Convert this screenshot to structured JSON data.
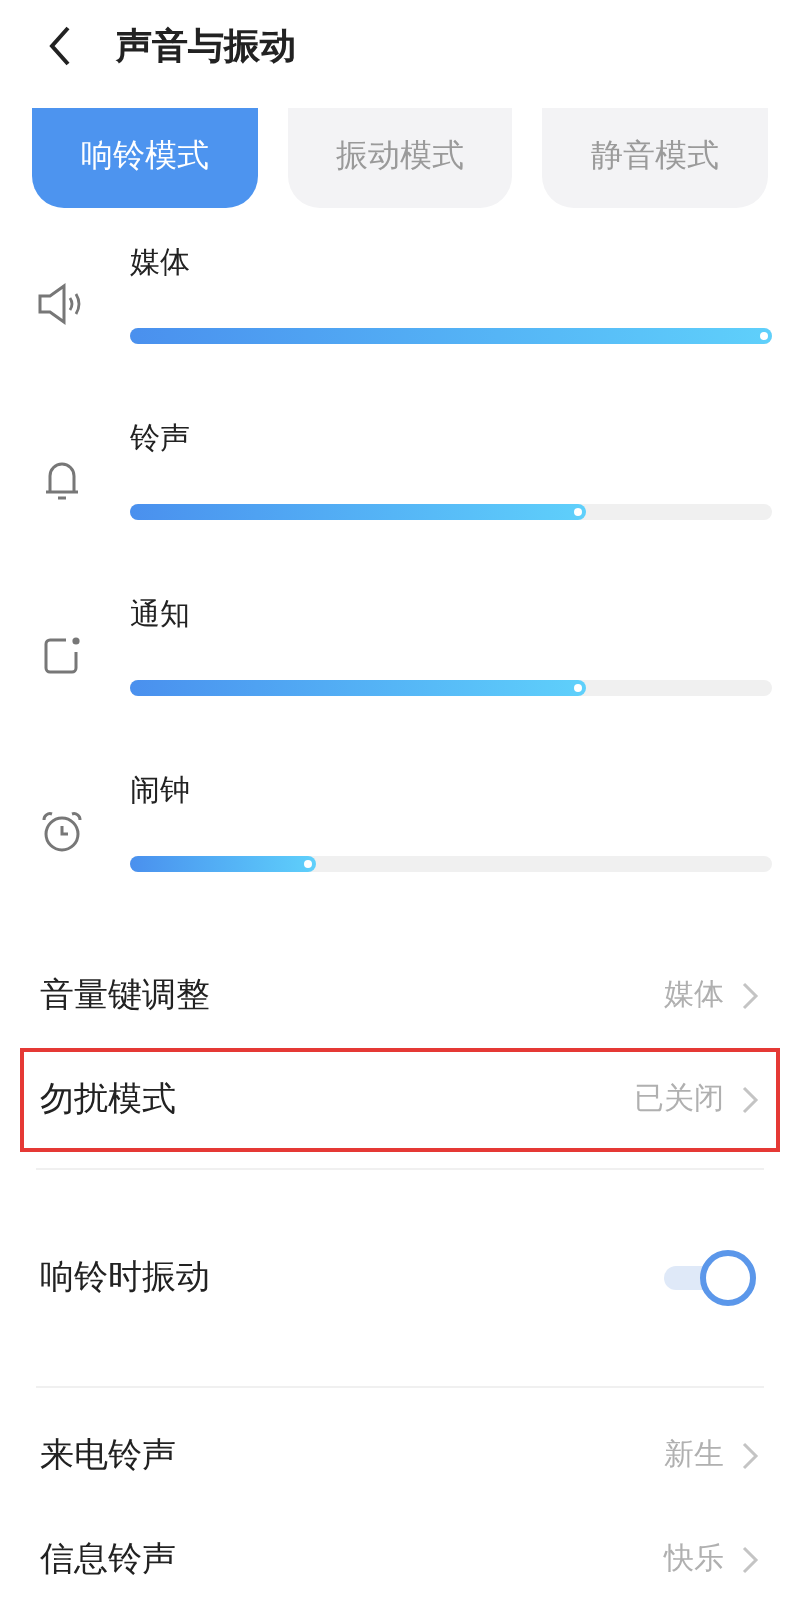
{
  "header": {
    "title": "声音与振动"
  },
  "modes": [
    {
      "label": "响铃模式",
      "selected": true
    },
    {
      "label": "振动模式",
      "selected": false
    },
    {
      "label": "静音模式",
      "selected": false
    }
  ],
  "volumes": [
    {
      "kind": "speaker",
      "label": "媒体",
      "level": 1.0
    },
    {
      "kind": "bell",
      "label": "铃声",
      "level": 0.71
    },
    {
      "kind": "notification",
      "label": "通知",
      "level": 0.71
    },
    {
      "kind": "alarm",
      "label": "闹钟",
      "level": 0.29
    }
  ],
  "settings": [
    {
      "kind": "link",
      "label": "音量键调整",
      "value": "媒体",
      "highlighted": false,
      "divider": false
    },
    {
      "kind": "link",
      "label": "勿扰模式",
      "value": "已关闭",
      "highlighted": true,
      "divider": true
    },
    {
      "kind": "toggle",
      "label": "响铃时振动",
      "on": true,
      "divider": true
    },
    {
      "kind": "link",
      "label": "来电铃声",
      "value": "新生",
      "highlighted": false,
      "divider": false
    },
    {
      "kind": "link",
      "label": "信息铃声",
      "value": "快乐",
      "highlighted": false,
      "divider": false
    }
  ]
}
